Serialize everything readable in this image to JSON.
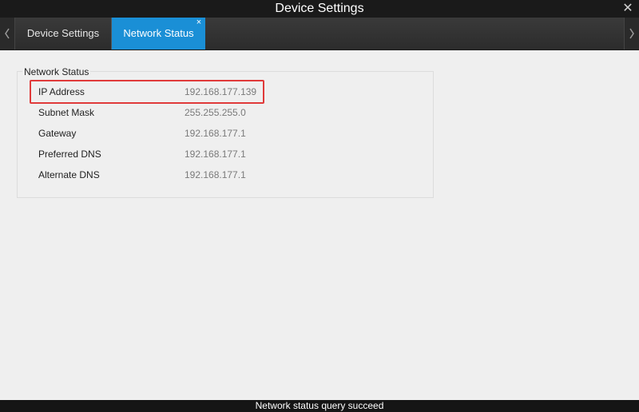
{
  "window": {
    "title": "Device Settings",
    "close_icon": "close-icon"
  },
  "tabs": [
    {
      "label": "Device Settings",
      "active": false
    },
    {
      "label": "Network Status",
      "active": true,
      "close_glyph": "×"
    }
  ],
  "colors": {
    "active_tab": "#1a8fd6",
    "highlight_border": "#e03a3a"
  },
  "network_status": {
    "group_title": "Network Status",
    "rows": [
      {
        "label": "IP Address",
        "value": "192.168.177.139"
      },
      {
        "label": "Subnet Mask",
        "value": "255.255.255.0"
      },
      {
        "label": "Gateway",
        "value": "192.168.177.1"
      },
      {
        "label": "Preferred DNS",
        "value": "192.168.177.1"
      },
      {
        "label": "Alternate DNS",
        "value": "192.168.177.1"
      }
    ]
  },
  "status_bar": {
    "message": "Network status query succeed"
  }
}
